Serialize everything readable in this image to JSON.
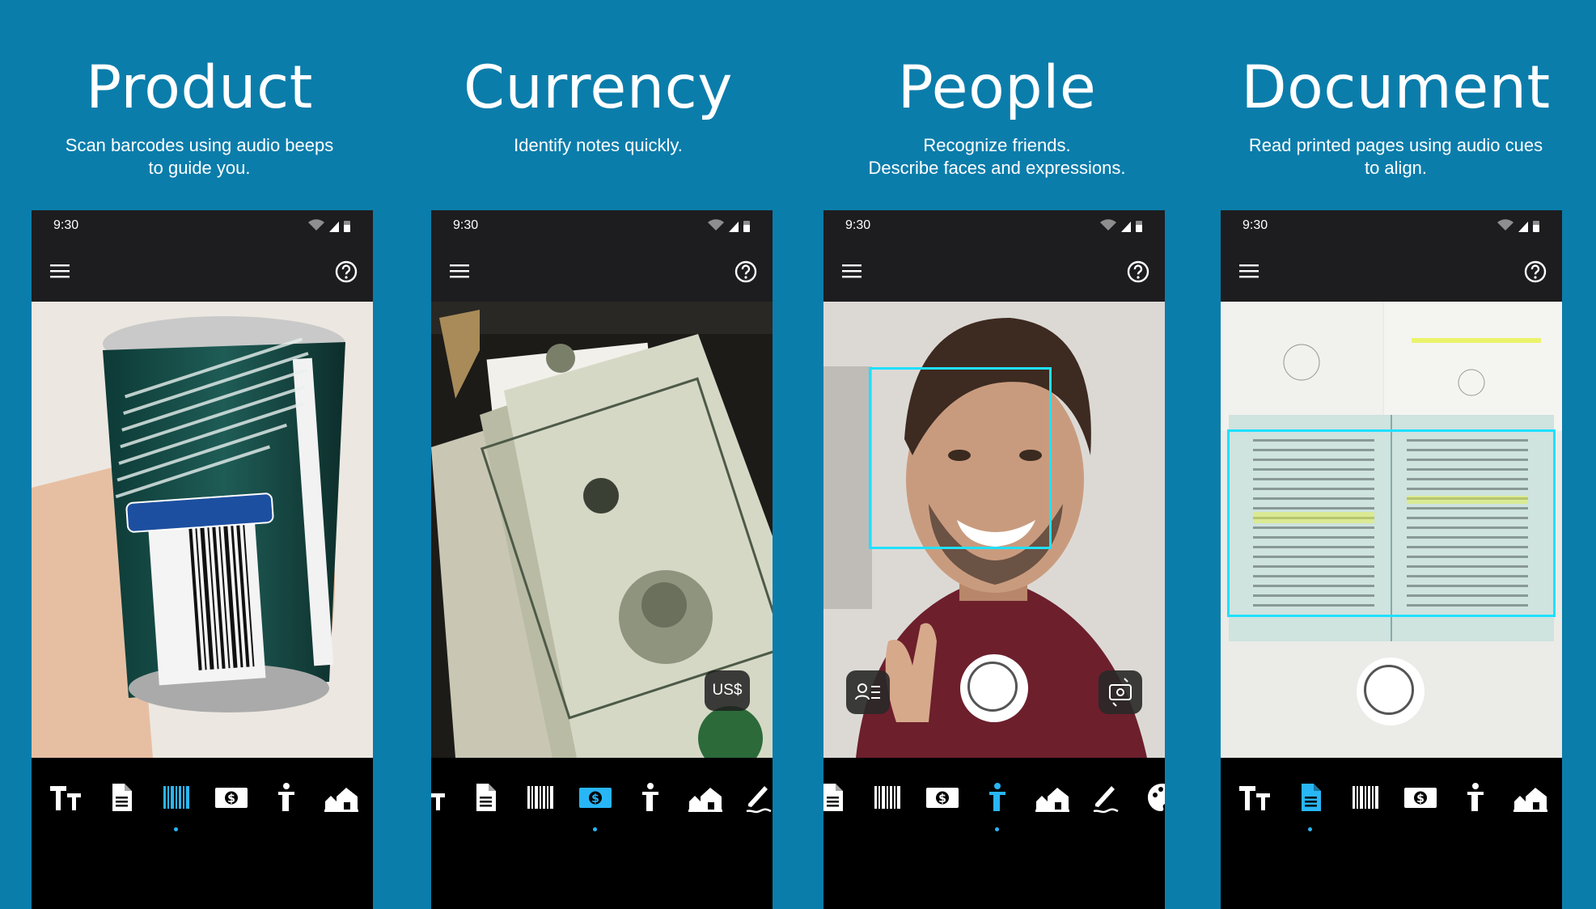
{
  "colors": {
    "background": "#0b7dab",
    "accent": "#29b6f6",
    "highlight_box": "#1fe0ff"
  },
  "panels": [
    {
      "title": "Product",
      "subtitle_line1": "Scan barcodes using audio beeps",
      "subtitle_line2": "to guide you.",
      "time": "9:30",
      "active_tab": "product-barcode"
    },
    {
      "title": "Currency",
      "subtitle_line1": "Identify notes quickly.",
      "subtitle_line2": "",
      "time": "9:30",
      "currency_badge": "US$",
      "active_tab": "currency"
    },
    {
      "title": "People",
      "subtitle_line1": "Recognize friends.",
      "subtitle_line2": "Describe faces and expressions.",
      "time": "9:30",
      "active_tab": "person"
    },
    {
      "title": "Document",
      "subtitle_line1": "Read printed pages using audio cues",
      "subtitle_line2": "to align.",
      "time": "9:30",
      "active_tab": "document"
    }
  ],
  "icons": [
    "menu-icon",
    "help-icon",
    "short-text-icon",
    "document-icon",
    "barcode-icon",
    "currency-icon",
    "person-icon",
    "scene-icon",
    "handwriting-icon",
    "color-icon"
  ]
}
